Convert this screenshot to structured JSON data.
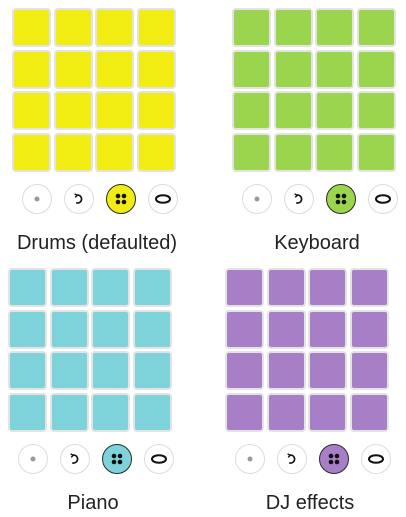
{
  "instruments": [
    {
      "id": "drums",
      "label": "Drums (defaulted)",
      "color": "#f1ec12",
      "rows": 4,
      "cols": 4
    },
    {
      "id": "keyboard",
      "label": "Keyboard",
      "color": "#9bd54d",
      "rows": 4,
      "cols": 4
    },
    {
      "id": "piano",
      "label": "Piano",
      "color": "#7ed3da",
      "rows": 4,
      "cols": 4
    },
    {
      "id": "dj",
      "label": "DJ effects",
      "color": "#a77fc6",
      "rows": 4,
      "cols": 4
    }
  ],
  "controls": [
    {
      "id": "record",
      "icon": "dot-icon"
    },
    {
      "id": "undo",
      "icon": "undo-icon"
    },
    {
      "id": "pad-layout",
      "icon": "grid-icon",
      "active": true
    },
    {
      "id": "loop",
      "icon": "loop-icon"
    }
  ]
}
